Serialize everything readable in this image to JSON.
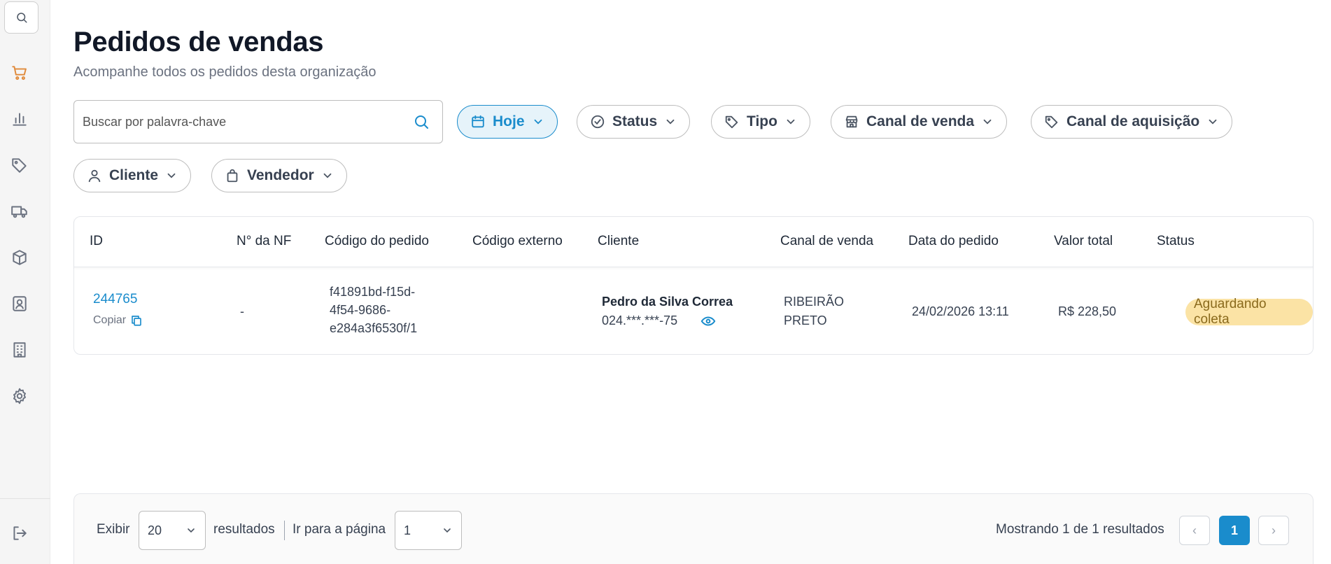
{
  "sidebar": {
    "items": [
      {
        "icon": "search-icon"
      },
      {
        "icon": "cart-icon",
        "active": true
      },
      {
        "icon": "bar-chart-icon"
      },
      {
        "icon": "tag-icon"
      },
      {
        "icon": "truck-icon"
      },
      {
        "icon": "box-icon"
      },
      {
        "icon": "contact-icon"
      },
      {
        "icon": "building-icon"
      },
      {
        "icon": "gear-icon"
      },
      {
        "icon": "logout-icon"
      }
    ]
  },
  "header": {
    "title": "Pedidos de vendas",
    "subtitle": "Acompanhe todos os pedidos desta organização"
  },
  "search": {
    "placeholder": "Buscar por palavra-chave",
    "value": ""
  },
  "filters": [
    {
      "label": "Hoje",
      "icon": "calendar-icon",
      "active": true
    },
    {
      "label": "Status",
      "icon": "check-circle-icon"
    },
    {
      "label": "Tipo",
      "icon": "tag-icon"
    },
    {
      "label": "Canal de venda",
      "icon": "store-icon"
    },
    {
      "label": "Canal de aquisição",
      "icon": "tag-icon"
    },
    {
      "label": "Cliente",
      "icon": "user-icon"
    },
    {
      "label": "Vendedor",
      "icon": "bag-icon"
    }
  ],
  "table": {
    "columns": [
      "ID",
      "N° da NF",
      "Código do pedido",
      "Código externo",
      "Cliente",
      "Canal de venda",
      "Data do pedido",
      "Valor total",
      "Status"
    ],
    "rows": [
      {
        "id": "244765",
        "copy_label": "Copiar",
        "nf": "-",
        "order_code_lines": [
          "f41891bd-f15d-",
          "4f54-9686-",
          "e284a3f6530f/1"
        ],
        "external_code": "",
        "client_name": "Pedro da Silva Correa",
        "client_doc": "024.***.***-75",
        "channel_lines": [
          "RIBEIRÃO",
          "PRETO"
        ],
        "date": "24/02/2026 13:11",
        "total": "R$ 228,50",
        "status": "Aguardando coleta"
      }
    ]
  },
  "footer": {
    "show_label": "Exibir",
    "per_page": "20",
    "results_label": "resultados",
    "goto_label": "Ir para a página",
    "page_select": "1",
    "summary": "Mostrando 1 de 1 resultados",
    "prev": "‹",
    "current_page": "1",
    "next": "›"
  },
  "colors": {
    "accent": "#1a8ccc",
    "active_nav": "#e08a3a",
    "status_badge_bg": "#fbe3a5"
  }
}
